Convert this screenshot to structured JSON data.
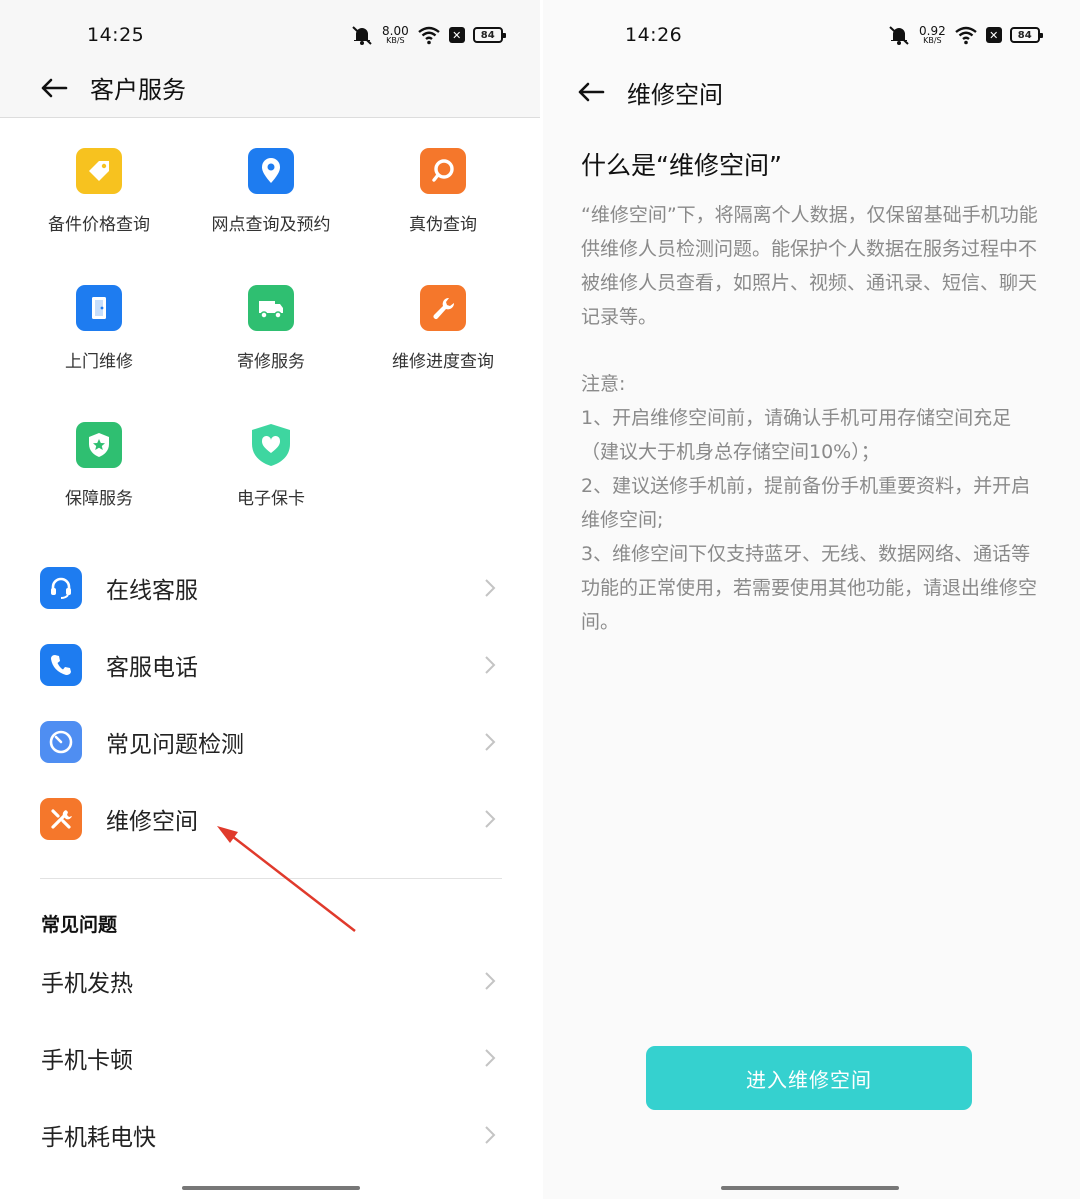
{
  "left": {
    "status": {
      "time": "14:25",
      "speed_value": "8.00",
      "speed_unit": "KB/S",
      "battery": "84"
    },
    "header": {
      "title": "客户服务"
    },
    "grid": [
      {
        "label": "备件价格查询",
        "icon": "price-tag-icon",
        "color": "#f7c21f"
      },
      {
        "label": "网点查询及预约",
        "icon": "location-pin-icon",
        "color": "#1e7cf0"
      },
      {
        "label": "真伪查询",
        "icon": "magnifier-icon",
        "color": "#f5772b"
      },
      {
        "label": "上门维修",
        "icon": "door-icon",
        "color": "#1e7cf0"
      },
      {
        "label": "寄修服务",
        "icon": "truck-icon",
        "color": "#2fbf71"
      },
      {
        "label": "维修进度查询",
        "icon": "wrench-icon",
        "color": "#f5772b"
      },
      {
        "label": "保障服务",
        "icon": "shield-star-icon",
        "color": "#2fbf71"
      },
      {
        "label": "电子保卡",
        "icon": "heart-shield-icon",
        "color": "#3ed6a0"
      }
    ],
    "list": [
      {
        "label": "在线客服",
        "icon": "headset-icon",
        "color": "#1e7cf0"
      },
      {
        "label": "客服电话",
        "icon": "phone-icon",
        "color": "#1e7cf0"
      },
      {
        "label": "常见问题检测",
        "icon": "gauge-icon",
        "color": "#4f8ef2"
      },
      {
        "label": "维修空间",
        "icon": "tools-icon",
        "color": "#f5772b"
      }
    ],
    "faq": {
      "title": "常见问题",
      "items": [
        "手机发热",
        "手机卡顿",
        "手机耗电快"
      ]
    },
    "annotation_color": "#e03a2c"
  },
  "right": {
    "status": {
      "time": "14:26",
      "speed_value": "0.92",
      "speed_unit": "KB/S",
      "battery": "84"
    },
    "header": {
      "title": "维修空间"
    },
    "heading": "什么是“维修空间”",
    "intro": "“维修空间”下，将隔离个人数据，仅保留基础手机功能供维修人员检测问题。能保护个人数据在服务过程中不被维修人员查看，如照片、视频、通讯录、短信、聊天记录等。",
    "notes_title": "注意:",
    "notes": [
      "1、开启维修空间前，请确认手机可用存储空间充足（建议大于机身总存储空间10%）；",
      "2、建议送修手机前，提前备份手机重要资料，并开启维修空间;",
      "3、维修空间下仅支持蓝牙、无线、数据网络、通话等功能的正常使用，若需要使用其他功能，请退出维修空间。"
    ],
    "button_label": "进入维修空间",
    "button_color": "#35d1cf"
  }
}
